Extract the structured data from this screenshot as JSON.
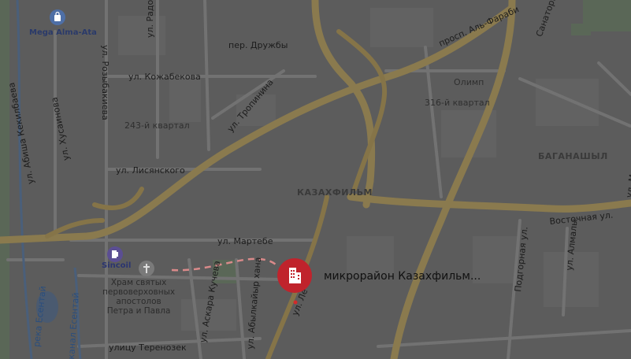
{
  "map": {
    "streets": {
      "radostovtsa": "ул. Радостовца",
      "druzhby": "пер. Дружбы",
      "rozybakieva": "ул. Розыбакиева",
      "kozhabekova": "ул. Кожабекова",
      "tropinina": "ул. Тропинина",
      "lisyanskogo": "ул. Лисянского",
      "abisha": "ул. Абиша Кекилбаева",
      "khusainova": "ул. Хусаинова",
      "martebe": "ул. Мартебе",
      "askara": "ул. Аскара Кучева",
      "abylkayyr": "ул. Абылкайыр хана",
      "terenozek": "улицу Теренозек",
      "al_farabi": "просп. Аль-Фараби",
      "sanatornaya": "Санаторная",
      "vostochnaya": "Восточная ул.",
      "podgornaya": "Подгорная ул.",
      "almaly": "ул. Алмалы",
      "ulm": "ул. М",
      "pin_street": "ул. Ле"
    },
    "places": {
      "q243": "243-й квартал",
      "q316": "316-й квартал",
      "olimp": "Олимп",
      "kazakhfilm": "КАЗАХФИЛЬМ",
      "bagashyl": "БАГАНАШЫЛ"
    },
    "water": {
      "esentai": "река Есентай",
      "kanal": "канал Есентай"
    },
    "pois": {
      "mega": "Mega Alma-Ata",
      "sincoil": "Sincoil",
      "church": "Храм святых первоверховных апостолов Петра и Павла"
    },
    "church_lines": [
      "Храм святых",
      "первоверховных",
      "апостолов",
      "Петра и Павла"
    ],
    "selected": {
      "label": "микрорайон Казахфильм...",
      "pin_color": "#c0232c"
    }
  }
}
